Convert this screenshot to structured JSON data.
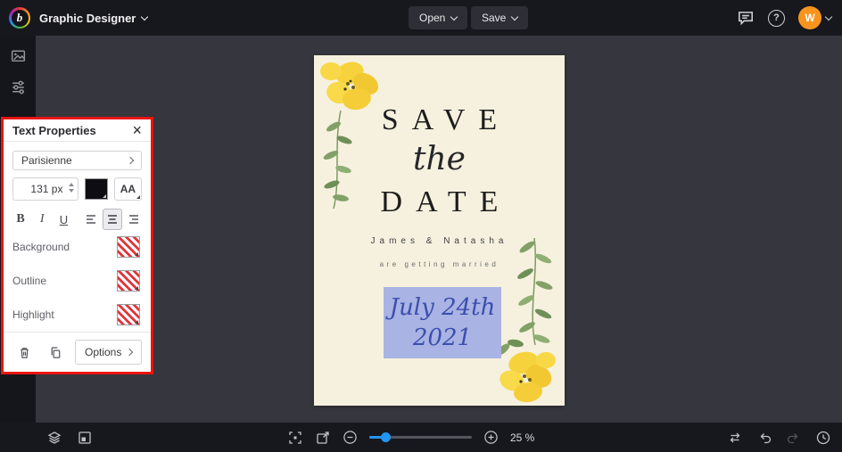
{
  "topbar": {
    "logo_letter": "b",
    "app_title": "Graphic Designer",
    "open_button": "Open",
    "save_button": "Save",
    "help_glyph": "?",
    "avatar_initial": "W"
  },
  "text_properties": {
    "title": "Text Properties",
    "close_glyph": "×",
    "font_family": "Parisienne",
    "font_size": "131 px",
    "case_toggle": "AA",
    "bold": "B",
    "italic": "I",
    "underline": "U",
    "background_label": "Background",
    "outline_label": "Outline",
    "highlight_label": "Highlight",
    "options_button": "Options"
  },
  "design": {
    "title_line1": "SAVE",
    "title_line2": "the",
    "title_line3": "DATE",
    "names_line": "James & Natasha",
    "subtitle_line": "are getting married",
    "date_line1": "July 24th",
    "date_line2": "2021"
  },
  "statusbar": {
    "zoom_value": "25 %"
  },
  "colors": {
    "accent_blue": "#2196f3",
    "annotation_red": "#ea140e",
    "avatar_orange": "#f7941e",
    "selection_fill": "#a9b3e4",
    "canvas_background": "#f6f1de",
    "date_text_blue": "#3b4fae"
  }
}
